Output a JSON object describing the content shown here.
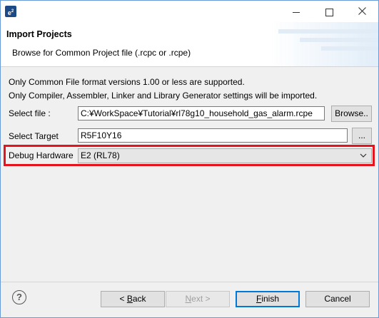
{
  "window": {
    "icon_text": "e",
    "icon_sup": "2"
  },
  "header": {
    "title": "Import Projects",
    "subtitle": "Browse for Common Project file (.rcpc or .rcpe)"
  },
  "info": {
    "line1": "Only Common File format versions 1.00 or less are supported.",
    "line2": "Only Compiler, Assembler, Linker and Library Generator settings will be imported."
  },
  "form": {
    "select_file_label": "Select file :",
    "select_file_value": "C:¥WorkSpace¥Tutorial¥rl78g10_household_gas_alarm.rcpe",
    "browse_label": "Browse..",
    "select_target_label": "Select Target",
    "select_target_value": "R5F10Y16",
    "target_browse_label": "...",
    "debug_hardware_label": "Debug Hardware",
    "debug_hardware_value": "E2 (RL78)"
  },
  "buttons": {
    "help_glyph": "?",
    "back_prefix": "< ",
    "back_mnemonic": "B",
    "back_rest": "ack",
    "next_mnemonic": "N",
    "next_rest": "ext >",
    "finish_mnemonic": "F",
    "finish_rest": "inish",
    "cancel_label": "Cancel"
  },
  "colors": {
    "highlight": "#e5131c",
    "primary_button_border": "#0078d7"
  }
}
